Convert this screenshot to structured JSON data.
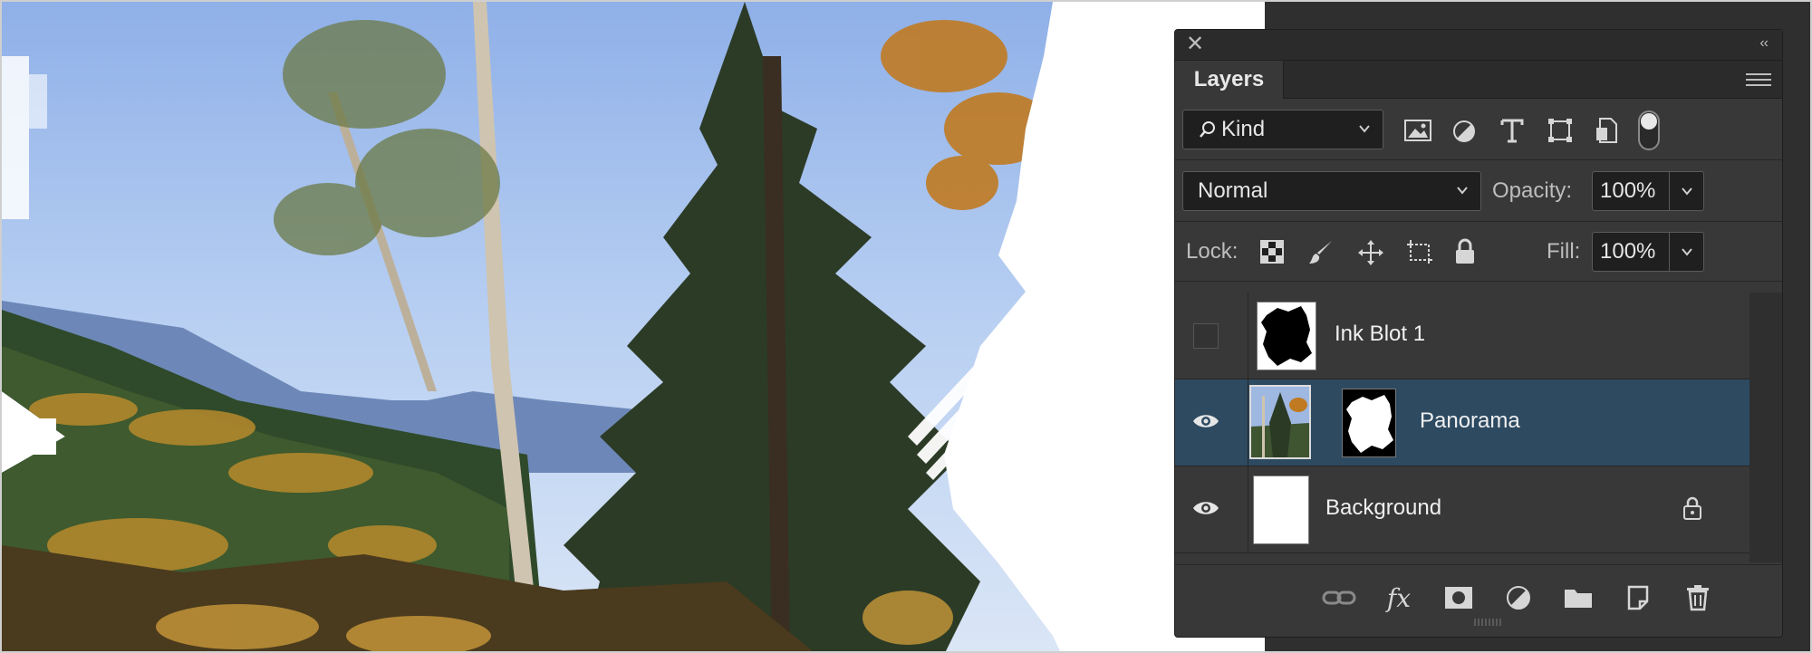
{
  "layers_panel": {
    "close_glyph": "✕",
    "collapse_glyph": "‹‹",
    "tab_title": "Layers",
    "menu_icon": "hamburger-menu-icon",
    "filter": {
      "kind_label": "Kind",
      "filter_icons": [
        "image-filter-icon",
        "adjustment-filter-icon",
        "type-filter-icon",
        "shape-filter-icon",
        "smart-object-filter-icon",
        "filter-toggle-icon"
      ]
    },
    "blend_mode": "Normal",
    "opacity_label": "Opacity:",
    "opacity_value": "100%",
    "lock_label": "Lock:",
    "lock_icons": [
      "lock-transparent-pixels-icon",
      "lock-image-pixels-icon",
      "lock-position-icon",
      "lock-artboard-icon",
      "lock-all-icon"
    ],
    "fill_label": "Fill:",
    "fill_value": "100%",
    "layers": [
      {
        "name": "Ink Blot 1",
        "visible": false,
        "selected": false,
        "locked": false
      },
      {
        "name": "Panorama",
        "visible": true,
        "selected": true,
        "locked": false
      },
      {
        "name": "Background",
        "visible": true,
        "selected": false,
        "locked": true
      }
    ],
    "footer_icons": [
      "link-layers-icon",
      "fx-icon",
      "add-mask-icon",
      "adjustment-layer-icon",
      "new-group-folder-icon",
      "new-layer-icon",
      "trash-icon"
    ],
    "fx_label": "fx"
  },
  "colors": {
    "panel_bg": "#383838",
    "selected_row": "#2d4a61",
    "workspace_bg": "#2f2f2f"
  }
}
